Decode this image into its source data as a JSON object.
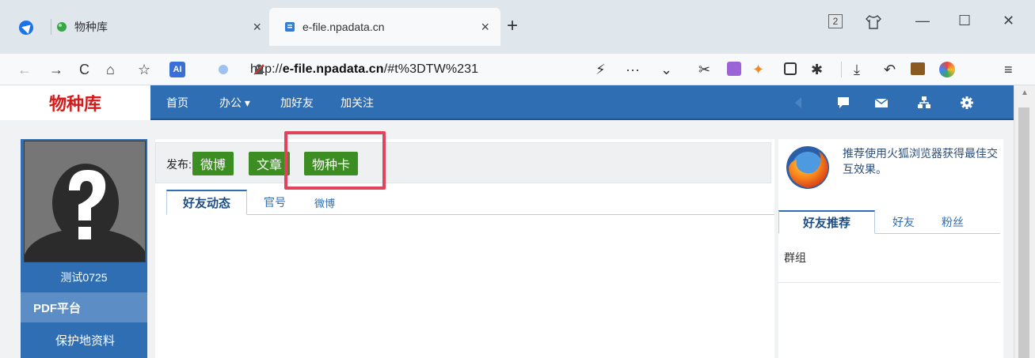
{
  "browser": {
    "tabs": [
      {
        "label": "物种库",
        "active": false
      },
      {
        "label": "e-file.npadata.cn",
        "active": true
      }
    ],
    "new_tab_label": "+",
    "tab_close_label": "×",
    "window_controls": {
      "badge": "2",
      "minimize": "—",
      "maximize": "☐",
      "close": "✕"
    },
    "address": {
      "scheme": "http://",
      "host": "e-file.npadata.cn",
      "path": "/#t%3DTW%231"
    }
  },
  "site": {
    "brand": "物种库",
    "brand_color": "#d21c1c",
    "accent_color": "#2f6eb3",
    "nav": [
      {
        "label": "首页"
      },
      {
        "label": "办公 ▾"
      },
      {
        "label": "加好友"
      },
      {
        "label": "加关注"
      }
    ],
    "nav_icons": [
      "comment-icon",
      "mail-icon",
      "sitemap-icon",
      "settings-icon"
    ]
  },
  "profile": {
    "username": "测试0725",
    "menu": [
      {
        "label": "PDF平台"
      },
      {
        "label": "保护地资料"
      }
    ]
  },
  "publish": {
    "label": "发布:",
    "buttons": [
      {
        "label": "微博"
      },
      {
        "label": "文章"
      },
      {
        "label": "物种卡"
      }
    ],
    "button_color": "#3c8e22",
    "highlight_color": "#e0435b"
  },
  "center_tabs": [
    {
      "label": "好友动态",
      "active": true
    },
    {
      "label": "官号",
      "active": false
    },
    {
      "label": "微博",
      "active": false
    }
  ],
  "right_panel": {
    "browser_tip": "推荐使用火狐浏览器获得最佳交互效果。",
    "tabs": [
      {
        "label": "好友推荐",
        "active": true
      },
      {
        "label": "好友",
        "active": false
      },
      {
        "label": "粉丝",
        "active": false
      }
    ],
    "group_label": "群组"
  }
}
